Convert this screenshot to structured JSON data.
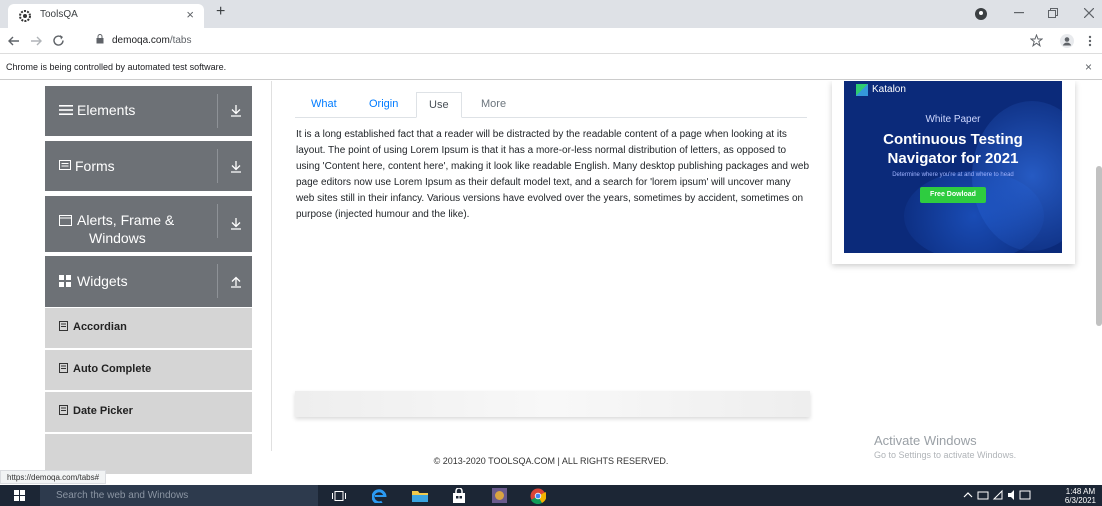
{
  "browser": {
    "tab_title": "ToolsQA",
    "tab_close": "×",
    "new_tab": "+",
    "url_host": "demoqa.com",
    "url_path": "/tabs",
    "infobar_text": "Chrome is being controlled by automated test software.",
    "infobar_close": "×",
    "status_url": "https://demoqa.com/tabs#"
  },
  "sidebar": {
    "groups": [
      {
        "label": "Elements",
        "icon": "menu-icon"
      },
      {
        "label": "Forms",
        "icon": "form-icon"
      },
      {
        "label": "Alerts, Frame & Windows",
        "label_line1": "Alerts, Frame &",
        "label_line2": "Windows",
        "icon": "window-icon"
      },
      {
        "label": "Widgets",
        "icon": "grid-icon",
        "expanded": true
      }
    ],
    "items": [
      {
        "label": "Accordian",
        "icon": "item-icon"
      },
      {
        "label": "Auto Complete",
        "icon": "item-icon"
      },
      {
        "label": "Date Picker",
        "icon": "item-icon"
      }
    ]
  },
  "tabs": {
    "items": [
      {
        "label": "What"
      },
      {
        "label": "Origin"
      },
      {
        "label": "Use",
        "active": true
      },
      {
        "label": "More",
        "disabled": true
      }
    ],
    "content": "It is a long established fact that a reader will be distracted by the readable content of a page when looking at its layout. The point of using Lorem Ipsum is that it has a more-or-less normal distribution of letters, as opposed to using 'Content here, content here', making it look like readable English. Many desktop publishing packages and web page editors now use Lorem Ipsum as their default model text, and a search for 'lorem ipsum' will uncover many web sites still in their infancy. Various versions have evolved over the years, sometimes by accident, sometimes on purpose (injected humour and the like)."
  },
  "banner": {
    "brand": "Katalon",
    "subtitle": "White Paper",
    "title_line1": "Continuous Testing",
    "title_line2": "Navigator for 2021",
    "small": "Determine where you're at and where to head",
    "button": "Free Dowload"
  },
  "footer": {
    "copyright": "© 2013-2020 TOOLSQA.COM | ALL RIGHTS RESERVED."
  },
  "watermark": {
    "line1": "Activate Windows",
    "line2": "Go to Settings to activate Windows."
  },
  "taskbar": {
    "search_placeholder": "Search the web and Windows",
    "time": "1:48 AM",
    "date": "6/3/2021"
  },
  "colors": {
    "sidebar_group": "#6d7176",
    "sidebar_item": "#d5d5d5",
    "tab_link": "#007bff",
    "banner_bg": "#0b2a7a",
    "banner_button": "#2ecc40",
    "taskbar": "#1c2635"
  }
}
